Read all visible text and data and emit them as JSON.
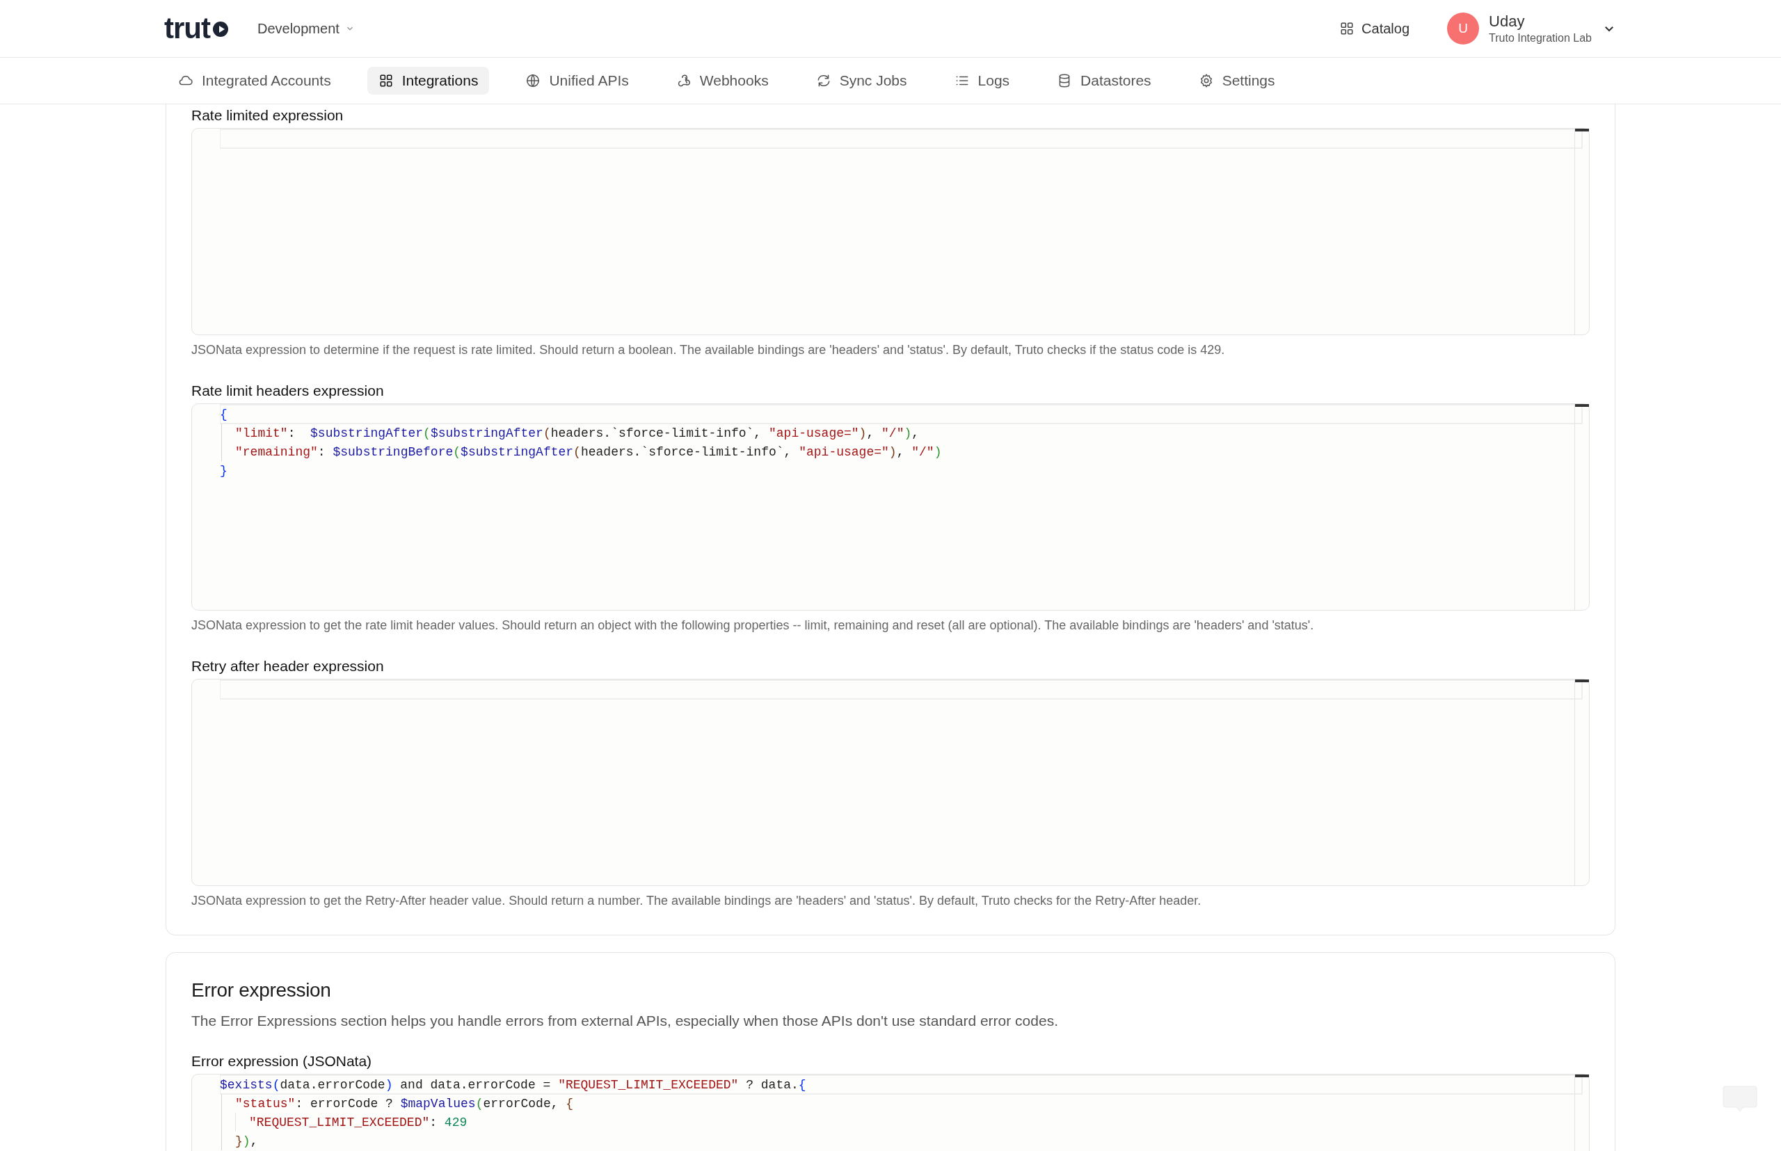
{
  "header": {
    "logo": "trut",
    "environment": "Development",
    "catalog": "Catalog",
    "user": {
      "initial": "U",
      "name": "Uday",
      "team": "Truto Integration Lab"
    }
  },
  "nav": [
    {
      "label": "Integrated Accounts",
      "selected": false
    },
    {
      "label": "Integrations",
      "selected": true
    },
    {
      "label": "Unified APIs",
      "selected": false
    },
    {
      "label": "Webhooks",
      "selected": false
    },
    {
      "label": "Sync Jobs",
      "selected": false
    },
    {
      "label": "Logs",
      "selected": false
    },
    {
      "label": "Datastores",
      "selected": false
    },
    {
      "label": "Settings",
      "selected": false
    }
  ],
  "rate_limit_card": {
    "fields": [
      {
        "label": "Rate limited expression",
        "help": "JSONata expression to determine if the request is rate limited. Should return a boolean. The available bindings are 'headers' and 'status'. By default, Truto checks if the status code is 429."
      },
      {
        "label": "Rate limit headers expression",
        "code": [
          {
            "tokens": [
              {
                "kind": "bracket1",
                "text": "{"
              }
            ],
            "children": [
              {
                "tokens": [
                  {
                    "kind": "key",
                    "text": "\"limit\""
                  },
                  {
                    "kind": "text",
                    "text": ":  "
                  },
                  {
                    "kind": "function",
                    "text": "$substringAfter"
                  },
                  {
                    "kind": "bracket2",
                    "text": "("
                  },
                  {
                    "kind": "function",
                    "text": "$substringAfter"
                  },
                  {
                    "kind": "bracket3",
                    "text": "("
                  },
                  {
                    "kind": "text",
                    "text": "headers.`sforce-limit-info`, "
                  },
                  {
                    "kind": "string",
                    "text": "\"api-usage=\""
                  },
                  {
                    "kind": "bracket3",
                    "text": ")"
                  },
                  {
                    "kind": "text",
                    "text": ", "
                  },
                  {
                    "kind": "string",
                    "text": "\"/\""
                  },
                  {
                    "kind": "bracket2",
                    "text": ")"
                  },
                  {
                    "kind": "text",
                    "text": ","
                  }
                ]
              },
              {
                "tokens": [
                  {
                    "kind": "key",
                    "text": "\"remaining\""
                  },
                  {
                    "kind": "text",
                    "text": ": "
                  },
                  {
                    "kind": "function",
                    "text": "$substringBefore"
                  },
                  {
                    "kind": "bracket2",
                    "text": "("
                  },
                  {
                    "kind": "function",
                    "text": "$substringAfter"
                  },
                  {
                    "kind": "bracket3",
                    "text": "("
                  },
                  {
                    "kind": "text",
                    "text": "headers.`sforce-limit-info`, "
                  },
                  {
                    "kind": "string",
                    "text": "\"api-usage=\""
                  },
                  {
                    "kind": "bracket3",
                    "text": ")"
                  },
                  {
                    "kind": "text",
                    "text": ", "
                  },
                  {
                    "kind": "string",
                    "text": "\"/\""
                  },
                  {
                    "kind": "bracket2",
                    "text": ")"
                  }
                ]
              }
            ]
          },
          {
            "tokens": [
              {
                "kind": "bracket1",
                "text": "}"
              }
            ]
          }
        ],
        "help": "JSONata expression to get the rate limit header values. Should return an object with the following properties -- limit, remaining and reset (all are optional). The available bindings are 'headers' and 'status'."
      },
      {
        "label": "Retry after header expression",
        "help": "JSONata expression to get the Retry-After header value. Should return a number. The available bindings are 'headers' and 'status'. By default, Truto checks for the Retry-After header."
      }
    ]
  },
  "error_card": {
    "title": "Error expression",
    "description": "The Error Expressions section helps you handle errors from external APIs, especially when those APIs don't use standard error codes.",
    "field": {
      "label": "Error expression (JSONata)",
      "code": [
        {
          "tokens": [
            {
              "kind": "function",
              "text": "$exists"
            },
            {
              "kind": "bracket1",
              "text": "("
            },
            {
              "kind": "text",
              "text": "data.errorCode"
            },
            {
              "kind": "bracket1",
              "text": ")"
            },
            {
              "kind": "text",
              "text": " and data.errorCode = "
            },
            {
              "kind": "string",
              "text": "\"REQUEST_LIMIT_EXCEEDED\""
            },
            {
              "kind": "text",
              "text": " ? data."
            },
            {
              "kind": "bracket1",
              "text": "{"
            }
          ],
          "children": [
            {
              "tokens": [
                {
                  "kind": "key",
                  "text": "\"status\""
                },
                {
                  "kind": "text",
                  "text": ": errorCode ? "
                },
                {
                  "kind": "function",
                  "text": "$mapValues"
                },
                {
                  "kind": "bracket2",
                  "text": "("
                },
                {
                  "kind": "text",
                  "text": "errorCode, "
                },
                {
                  "kind": "bracket3",
                  "text": "{"
                }
              ],
              "children": [
                {
                  "tokens": [
                    {
                      "kind": "key",
                      "text": "\"REQUEST_LIMIT_EXCEEDED\""
                    },
                    {
                      "kind": "text",
                      "text": ": "
                    },
                    {
                      "kind": "number",
                      "text": "429"
                    }
                  ]
                }
              ]
            },
            {
              "tokens": [
                {
                  "kind": "bracket3",
                  "text": "}"
                },
                {
                  "kind": "bracket2",
                  "text": ")"
                },
                {
                  "kind": "text",
                  "text": ","
                }
              ]
            }
          ]
        }
      ]
    }
  }
}
